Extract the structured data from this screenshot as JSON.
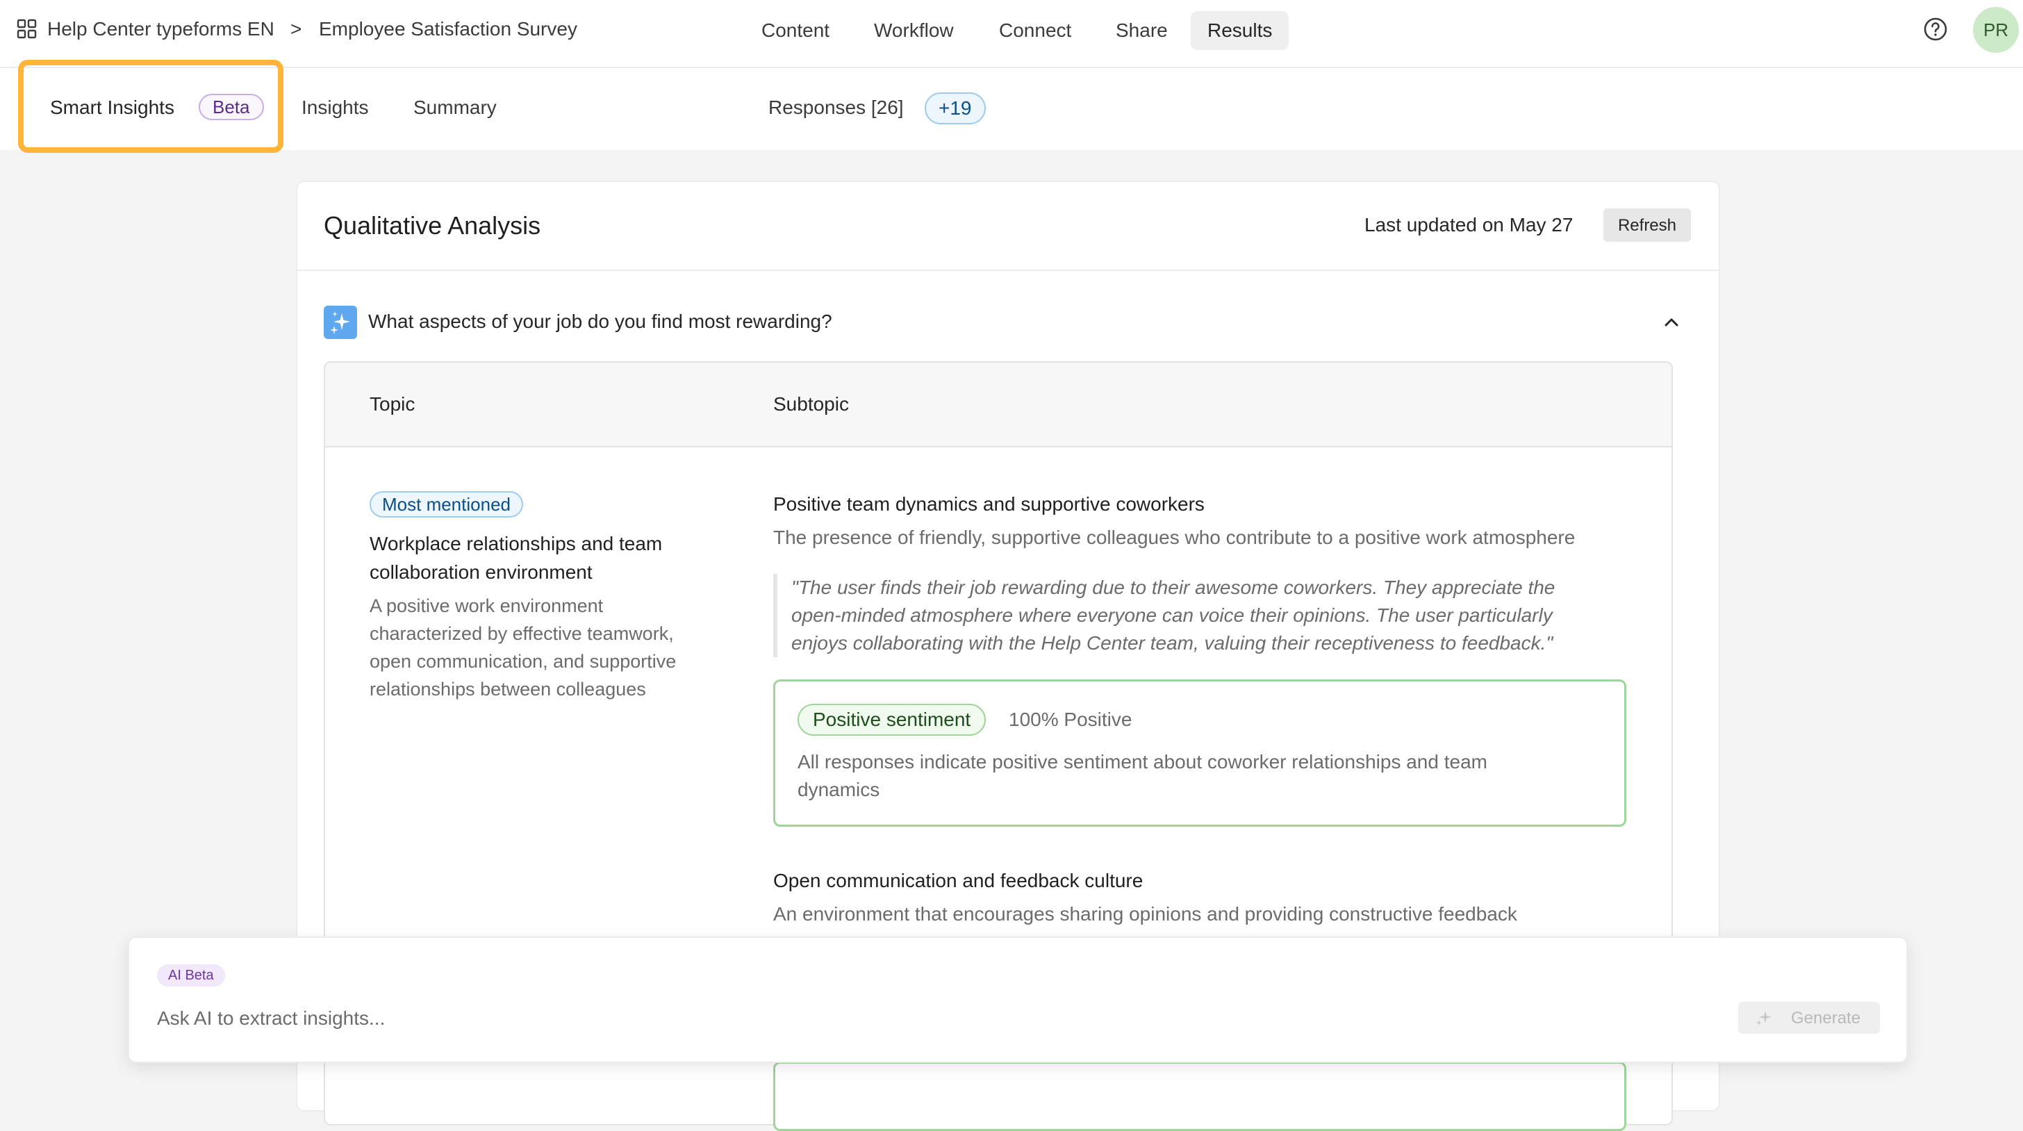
{
  "header": {
    "workspace": "Help Center typeforms EN",
    "separator": ">",
    "form_name": "Employee Satisfaction Survey",
    "nav": [
      "Content",
      "Workflow",
      "Connect",
      "Share",
      "Results"
    ],
    "active_nav": "Results",
    "avatar_initials": "PR"
  },
  "subnav": {
    "smart_insights": "Smart Insights",
    "beta_label": "Beta",
    "insights": "Insights",
    "summary": "Summary",
    "responses": "Responses [26]",
    "new_responses": "+19"
  },
  "card": {
    "title": "Qualitative Analysis",
    "last_updated": "Last updated on May 27",
    "refresh_label": "Refresh",
    "question": "What aspects of your job do you find most rewarding?",
    "table": {
      "col_topic": "Topic",
      "col_subtopic": "Subtopic",
      "topic": {
        "badge": "Most mentioned",
        "title": "Workplace relationships and team collaboration environment",
        "description": "A positive work environment characterized by effective teamwork, open communication, and supportive relationships between colleagues"
      },
      "subtopics": [
        {
          "title": "Positive team dynamics and supportive coworkers",
          "description": "The presence of friendly, supportive colleagues who contribute to a positive work atmosphere",
          "quote": "\"The user finds their job rewarding due to their awesome coworkers. They appreciate the open-minded atmosphere where everyone can voice their opinions. The user particularly enjoys collaborating with the Help Center team, valuing their receptiveness to feedback.\"",
          "sentiment_label": "Positive sentiment",
          "sentiment_pct": "100% Positive",
          "sentiment_desc": "All responses indicate positive sentiment about coworker relationships and team dynamics"
        },
        {
          "title": "Open communication and feedback culture",
          "description": "An environment that encourages sharing opinions and providing constructive feedback"
        }
      ]
    }
  },
  "ai_bar": {
    "badge": "AI Beta",
    "placeholder": "Ask AI to extract insights...",
    "generate_label": "Generate"
  },
  "colors": {
    "highlight": "#ffb53a",
    "sparkle_bg": "#5fa7ee",
    "sentiment_border": "#9fd49a",
    "badge_blue": "#0b4f8a",
    "beta_purple": "#5a2c8a"
  }
}
